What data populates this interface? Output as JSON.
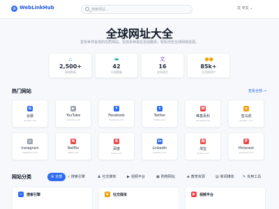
{
  "header": {
    "logo_text": "WebLinkHub",
    "search_placeholder": "搜索网站...",
    "language": "文 中文 ⌄"
  },
  "hero": {
    "title": "全球网址大全",
    "subtitle": "发现世界各地的优质网站，支持多种语言自动翻译，轻松浏览全球网络资源。"
  },
  "stats": [
    {
      "value": "2,500+",
      "label": "网站数量",
      "icon": "sitemap-icon",
      "color": "#2d6bf2",
      "glyph": "⛬"
    },
    {
      "value": "42",
      "label": "分类数量",
      "icon": "folder-icon",
      "color": "#13b3a8",
      "glyph": "▬"
    },
    {
      "value": "16",
      "label": "支持语言",
      "icon": "translate-icon",
      "color": "#7c3aed",
      "glyph": "文"
    },
    {
      "value": "85k+",
      "label": "月活跃用户",
      "icon": "users-icon",
      "color": "#f59e0b",
      "glyph": "●●"
    }
  ],
  "popular": {
    "title": "热门网站",
    "view_all": "查看全部 →",
    "sites": [
      {
        "name": "谷歌",
        "url": "google.com",
        "icon": "google-icon",
        "color": "#2d6bf2",
        "glyph": "G"
      },
      {
        "name": "YouTube",
        "url": "youtube.com",
        "icon": "youtube-icon",
        "color": "#9ca3af",
        "glyph": "▶"
      },
      {
        "name": "Facebook",
        "url": "facebook.com",
        "icon": "facebook-icon",
        "color": "#2d6bf2",
        "glyph": "f"
      },
      {
        "name": "Twitter",
        "url": "twitter.com",
        "icon": "twitter-icon",
        "color": "#2d6bf2",
        "glyph": "t"
      },
      {
        "name": "维基百科",
        "url": "wikipedia.org",
        "icon": "wikipedia-icon",
        "color": "#ef4444",
        "glyph": "W"
      },
      {
        "name": "亚马逊",
        "url": "amazon.com",
        "icon": "amazon-icon",
        "color": "#f59e0b",
        "glyph": "a"
      },
      {
        "name": "Instagram",
        "url": "instagram.com",
        "icon": "instagram-icon",
        "color": "#9ca3af",
        "glyph": "◎"
      },
      {
        "name": "Netflix",
        "url": "netflix.com",
        "icon": "netflix-icon",
        "color": "#ef4444",
        "glyph": "N"
      },
      {
        "name": "百度",
        "url": "baidu.com",
        "icon": "baidu-icon",
        "color": "#ef4444",
        "glyph": "B"
      },
      {
        "name": "LinkedIn",
        "url": "linkedin.com",
        "icon": "linkedin-icon",
        "color": "#2d6bf2",
        "glyph": "in"
      },
      {
        "name": "淘宝",
        "url": "taobao.com",
        "icon": "taobao-icon",
        "color": "#ef4444",
        "glyph": "淘"
      },
      {
        "name": "Pinterest",
        "url": "pinterest.com",
        "icon": "pinterest-icon",
        "color": "#ef4444",
        "glyph": "P"
      }
    ]
  },
  "categories": {
    "title": "网站分类",
    "tabs": [
      {
        "label": "全部",
        "glyph": "⊞",
        "icon": "grid-icon"
      },
      {
        "label": "搜索引擎",
        "glyph": "⌕",
        "icon": "search-icon"
      },
      {
        "label": "社交媒体",
        "glyph": "♟",
        "icon": "users-icon"
      },
      {
        "label": "视频平台",
        "glyph": "▶",
        "icon": "video-icon"
      },
      {
        "label": "购物网站",
        "glyph": "▣",
        "icon": "cart-icon"
      },
      {
        "label": "教育资源",
        "glyph": "◈",
        "icon": "graduation-icon"
      },
      {
        "label": "新闻媒体",
        "glyph": "▤",
        "icon": "newspaper-icon"
      },
      {
        "label": "实用工具",
        "glyph": "✎",
        "icon": "tools-icon"
      }
    ],
    "cards": [
      {
        "label": "搜索引擎",
        "icon": "search-icon",
        "color": "#2d6bf2",
        "glyph": "⌕"
      },
      {
        "label": "社交媒体",
        "icon": "users-icon",
        "color": "#f59e0b",
        "glyph": "♟"
      },
      {
        "label": "视频平台",
        "icon": "video-icon",
        "color": "#ef4444",
        "glyph": "▶"
      }
    ]
  }
}
